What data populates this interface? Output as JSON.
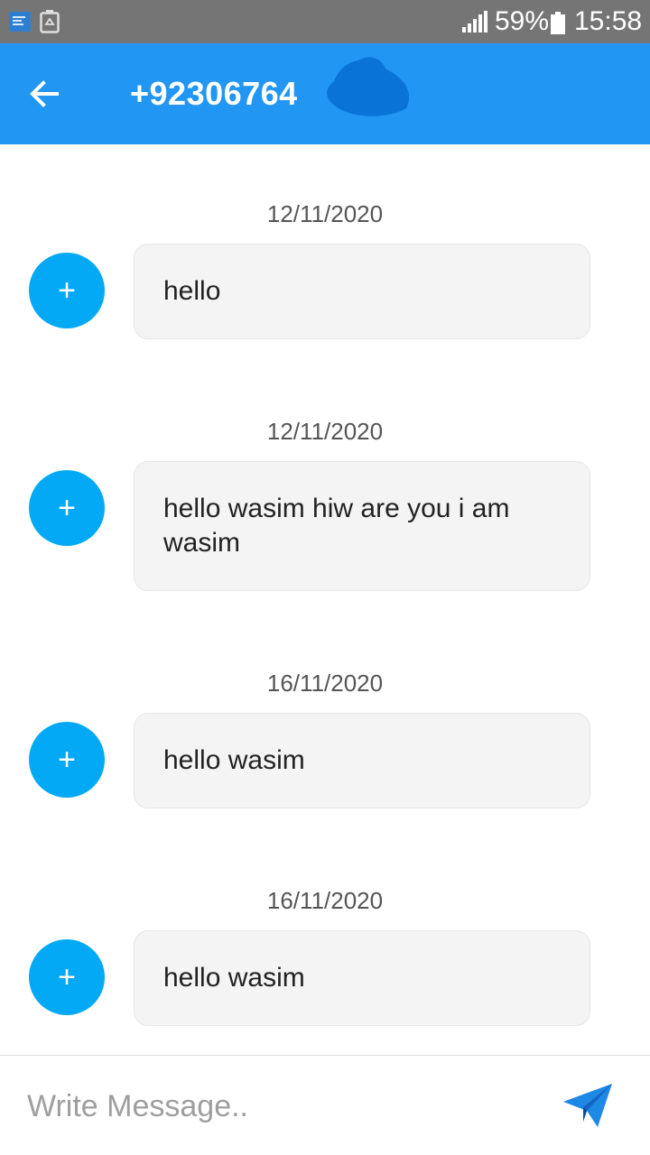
{
  "status_bar": {
    "battery_percent": "59%",
    "time": "15:58",
    "icons": [
      "notification-message-icon",
      "recycle-icon",
      "signal-icon",
      "battery-icon"
    ]
  },
  "header": {
    "title": "+92306764",
    "back_icon": "arrow-left-icon",
    "color": "#2196f3"
  },
  "messages": [
    {
      "date": "12/11/2020",
      "avatar_symbol": "+",
      "text": "hello"
    },
    {
      "date": "12/11/2020",
      "avatar_symbol": "+",
      "text": "hello wasim hiw are you i am wasim"
    },
    {
      "date": "16/11/2020",
      "avatar_symbol": "+",
      "text": "hello wasim"
    },
    {
      "date": "16/11/2020",
      "avatar_symbol": "+",
      "text": "hello wasim"
    }
  ],
  "composer": {
    "placeholder": "Write Message..",
    "value": "",
    "send_icon": "send-icon"
  },
  "colors": {
    "accent": "#2196f3",
    "avatar": "#03a9f4",
    "bubble_bg": "#f4f4f4"
  }
}
